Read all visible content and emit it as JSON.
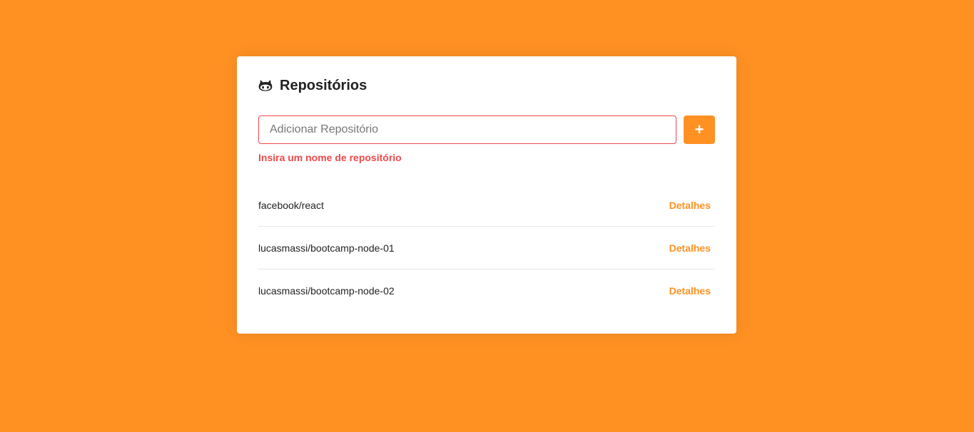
{
  "header": {
    "icon": "github-icon",
    "title": "Repositórios"
  },
  "form": {
    "input_placeholder": "Adicionar Repositório",
    "input_value": "",
    "add_button_label": "+",
    "add_button_color": "#ff9123",
    "error_message": "Insira um nome de repositório",
    "error_color": "#f0484a"
  },
  "repositories": [
    {
      "name": "facebook/react",
      "link_label": "Detalhes"
    },
    {
      "name": "lucasmassi/bootcamp-node-01",
      "link_label": "Detalhes"
    },
    {
      "name": "lucasmassi/bootcamp-node-02",
      "link_label": "Detalhes"
    }
  ],
  "colors": {
    "background": "#ff9123",
    "accent": "#ff9123"
  }
}
